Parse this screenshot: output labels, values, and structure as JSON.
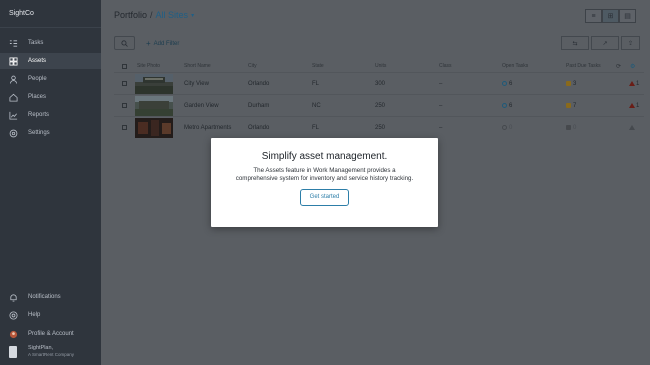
{
  "sidebar": {
    "brand": "SightCo",
    "nav": [
      {
        "label": "Tasks",
        "icon": "tasks-icon"
      },
      {
        "label": "Assets",
        "icon": "assets-icon",
        "active": true
      },
      {
        "label": "People",
        "icon": "person-icon"
      },
      {
        "label": "Places",
        "icon": "places-icon"
      },
      {
        "label": "Reports",
        "icon": "reports-icon"
      },
      {
        "label": "Settings",
        "icon": "gear-icon"
      }
    ],
    "bottom": [
      {
        "label": "Notifications",
        "icon": "bell-icon"
      },
      {
        "label": "Help",
        "icon": "help-icon"
      },
      {
        "label": "Profile & Account",
        "icon": "profile-icon"
      }
    ],
    "company": {
      "name": "SightPlan,",
      "sub": "A SmartRent Company"
    }
  },
  "header": {
    "crumb_root": "Portfolio",
    "separator": "/",
    "crumb_current": "All Sites"
  },
  "toolbar": {
    "add_filter": "Add Filter"
  },
  "table": {
    "columns": [
      "Site Photo",
      "Short Name",
      "City",
      "State",
      "Units",
      "Class",
      "Open Tasks",
      "Past Due Tasks"
    ],
    "rows": [
      {
        "name": "City View",
        "city": "Orlando",
        "state": "FL",
        "units": "300",
        "class": "–",
        "open": "6",
        "past_due": "3",
        "alerts": "1"
      },
      {
        "name": "Garden View",
        "city": "Durham",
        "state": "NC",
        "units": "250",
        "class": "–",
        "open": "6",
        "past_due": "7",
        "alerts": "1"
      },
      {
        "name": "Metro Apartments",
        "city": "Orlando",
        "state": "FL",
        "units": "250",
        "class": "–",
        "open": "0",
        "past_due": "0",
        "alerts": ""
      }
    ]
  },
  "modal": {
    "title": "Simplify asset management.",
    "body": "The Assets feature in Work Management provides a comprehensive system for inventory and service history tracking.",
    "cta": "Get started"
  },
  "colors": {
    "accent": "#2d7ea8",
    "sidebar_bg": "#2f353d",
    "overlay": "#5a5e63"
  }
}
